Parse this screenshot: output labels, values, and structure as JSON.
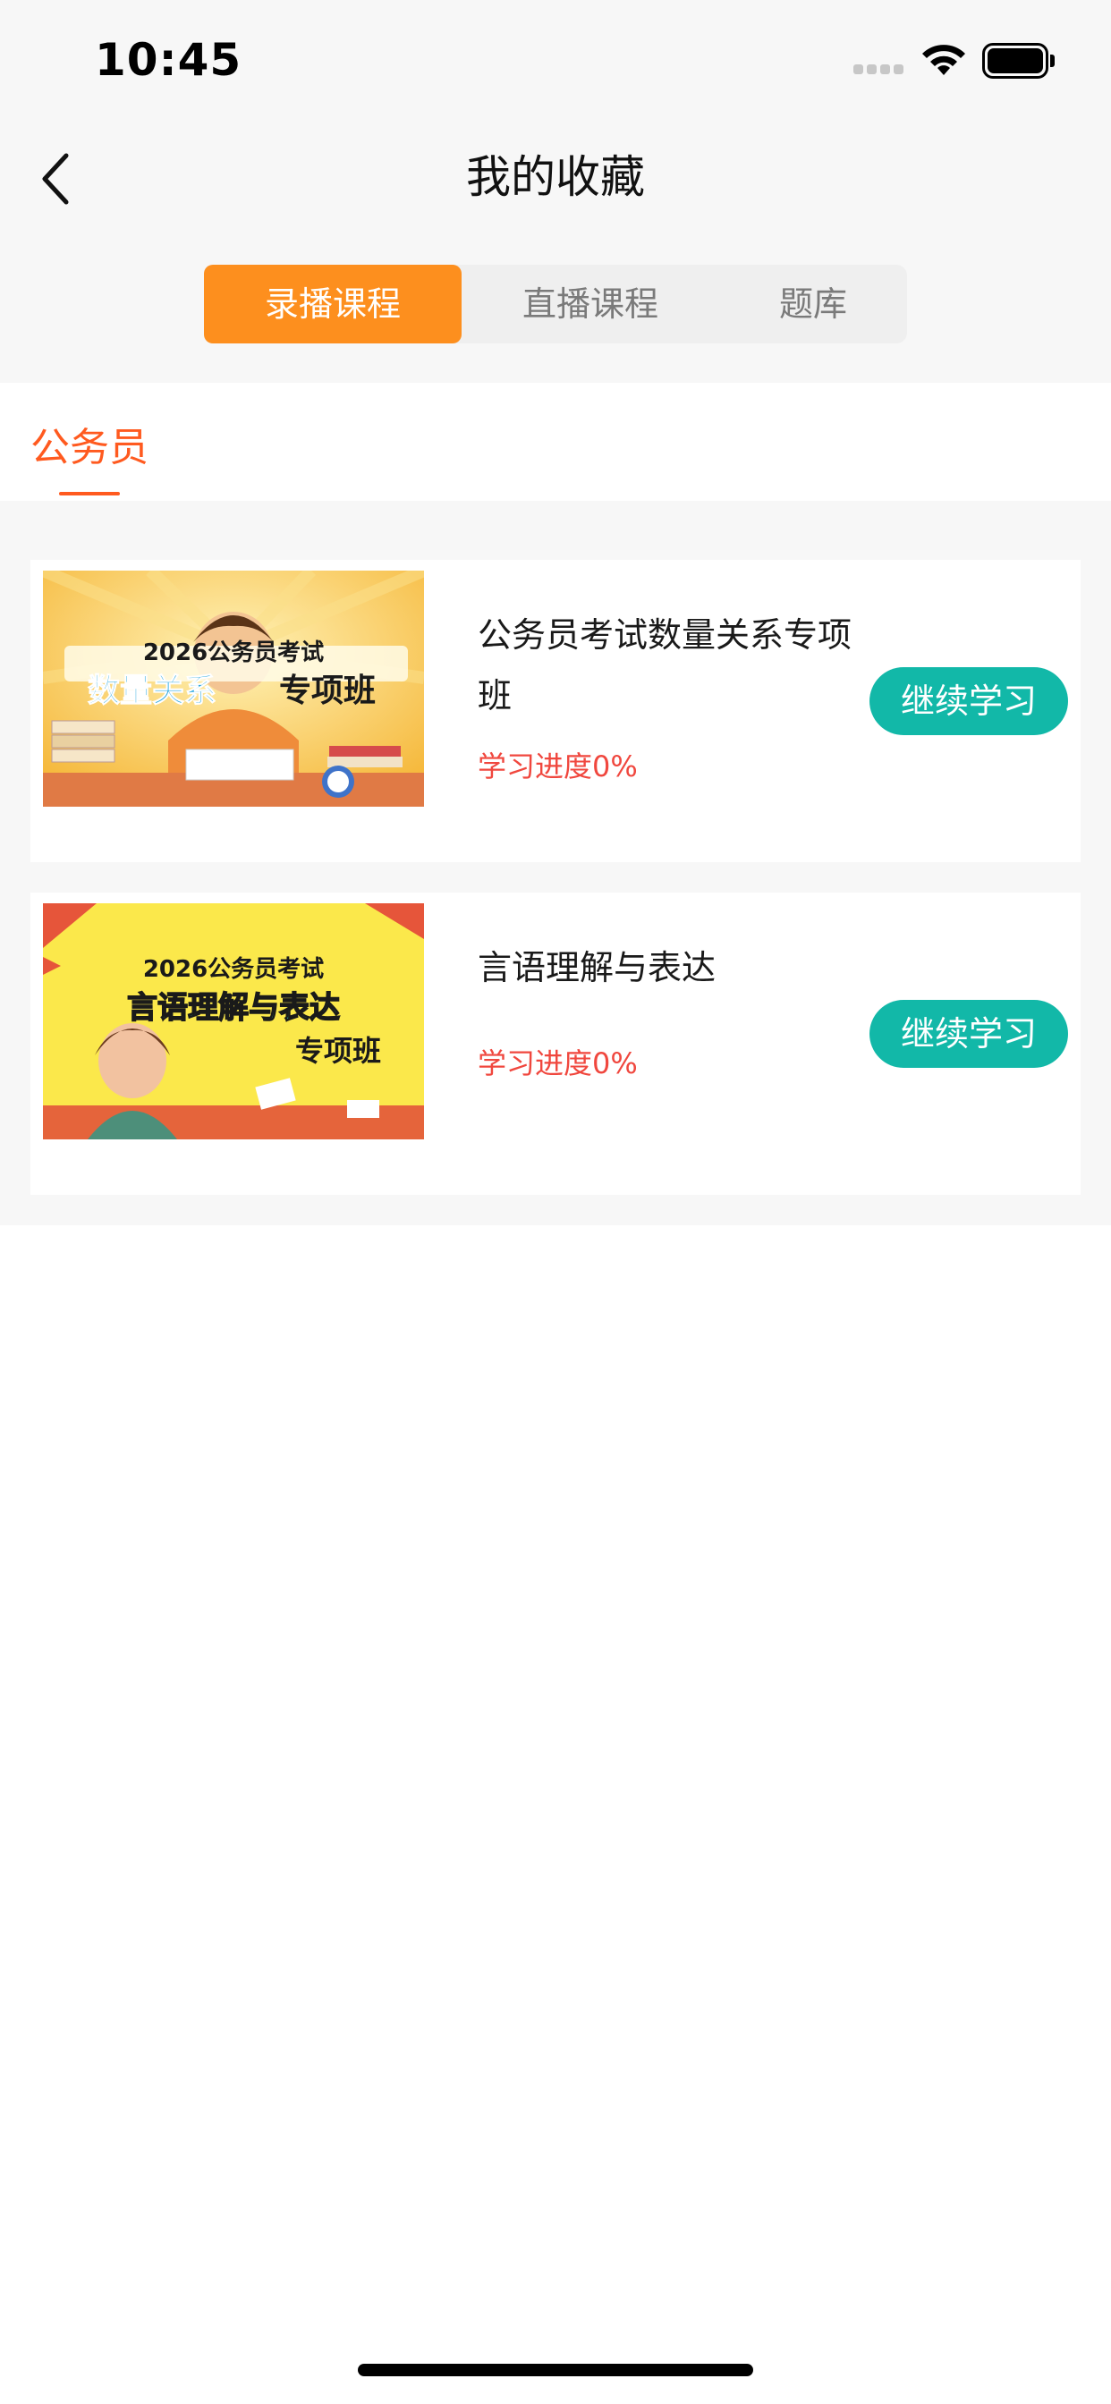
{
  "status_bar": {
    "time": "10:45"
  },
  "nav": {
    "title": "我的收藏"
  },
  "tabs": [
    {
      "label": "录播课程",
      "active": true
    },
    {
      "label": "直播课程",
      "active": false
    },
    {
      "label": "题库",
      "active": false
    }
  ],
  "category": {
    "label": "公务员"
  },
  "courses": [
    {
      "title": "公务员考试数量关系专项班",
      "progress": "学习进度0%",
      "button": "继续学习",
      "thumb": {
        "year_line": "2026公务员考试",
        "main_a": "数量关系",
        "main_b": "专项班"
      }
    },
    {
      "title": "言语理解与表达",
      "progress": "学习进度0%",
      "button": "继续学习",
      "thumb": {
        "year_line": "2026公务员考试",
        "main_a": "言语理解与表达",
        "main_b": "专项班"
      }
    }
  ],
  "colors": {
    "accent": "#fd8f1e",
    "progress": "#f0473e",
    "button": "#12b8a8",
    "category": "#ff5a1f"
  }
}
